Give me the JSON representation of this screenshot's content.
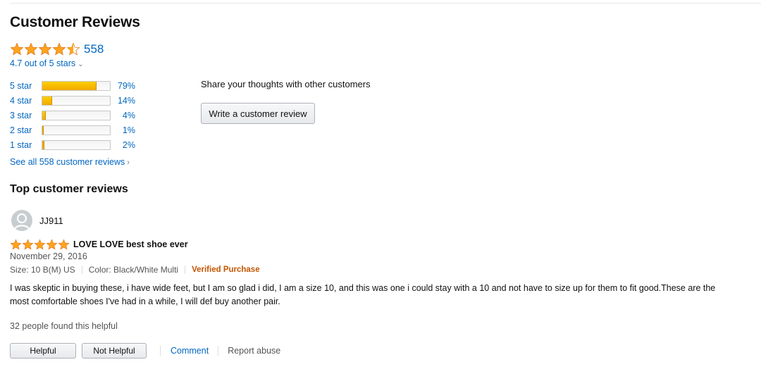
{
  "header": {
    "title": "Customer Reviews"
  },
  "summary": {
    "rating_count": "558",
    "out_of": "4.7 out of 5 stars",
    "caret": "⌄",
    "stars_filled": 4.5
  },
  "histogram": [
    {
      "label": "5 star",
      "percent": "79%",
      "fill_fraction": 0.79
    },
    {
      "label": "4 star",
      "percent": "14%",
      "fill_fraction": 0.14
    },
    {
      "label": "3 star",
      "percent": "4%",
      "fill_fraction": 0.04
    },
    {
      "label": "2 star",
      "percent": "1%",
      "fill_fraction": 0.01
    },
    {
      "label": "1 star",
      "percent": "2%",
      "fill_fraction": 0.02
    }
  ],
  "see_all": {
    "label": "See all 558 customer reviews",
    "chevron": "›"
  },
  "share": {
    "prompt": "Share your thoughts with other customers",
    "button_label": "Write a customer review"
  },
  "top_reviews": {
    "heading": "Top customer reviews",
    "review": {
      "reviewer": "JJ911",
      "stars_filled": 5,
      "title": "LOVE LOVE best shoe ever",
      "date": "November 29, 2016",
      "size": "Size: 10 B(M) US",
      "color": "Color: Black/White Multi",
      "verified": "Verified Purchase",
      "body": "I was skeptic in buying these, i have wide feet, but I am so glad i did, I am a size 10, and this was one i could stay with a 10 and not have to size up for them to fit good.These are the most comfortable shoes I've had in a while, I will def buy another pair.",
      "helpful_count": "32 people found this helpful",
      "helpful_label": "Helpful",
      "not_helpful_label": "Not Helpful",
      "comment_label": "Comment",
      "report_label": "Report abuse"
    }
  },
  "colors": {
    "link": "#0066c0",
    "star": "#ffa41c",
    "star_stroke": "#de7921",
    "verified": "#c45500"
  }
}
